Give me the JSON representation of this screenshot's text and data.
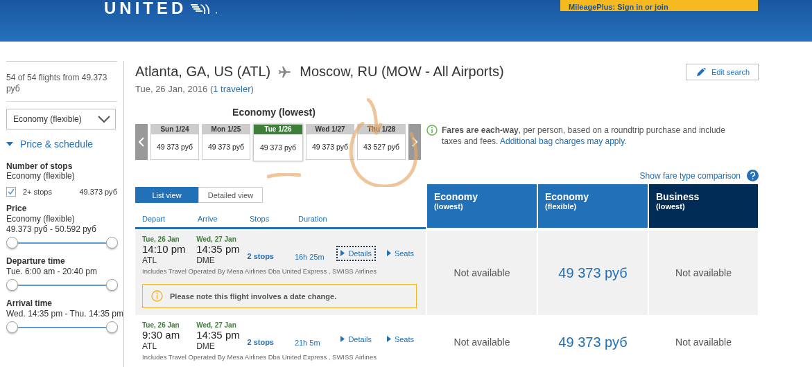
{
  "header": {
    "logo": "UNITED",
    "account_link": "MileagePlus: Sign in or join"
  },
  "sidebar": {
    "summary": "54 of 54 flights from 49.373 руб",
    "cabin_select": "Economy (flexible)",
    "section": {
      "label": "Price & schedule",
      "expanded": true
    },
    "stops": {
      "title": "Number of stops",
      "subtitle": "Economy (flexible)",
      "options": [
        {
          "label": "2+ stops",
          "price": "49.373 руб",
          "checked": true
        }
      ]
    },
    "filters": [
      {
        "title": "Price",
        "subtitle": "Economy (flexible)",
        "range": "49.373 руб - 50.592 руб",
        "thumbs": [
          {
            "level": 0
          },
          {
            "level": 1
          }
        ]
      },
      {
        "title": "Departure time",
        "range": "Tue. 6:00 am - 20:40 pm",
        "thumbs": [
          {
            "level": 0
          },
          {
            "level": 1
          }
        ]
      },
      {
        "title": "Arrival time",
        "range": "Wed. 14:35 pm - Thu. 14:35 pm",
        "thumbs": [
          {
            "level": 0
          },
          {
            "level": 1
          }
        ]
      }
    ]
  },
  "route": {
    "origin": "Atlanta, GA, US (ATL)",
    "destination": "Moscow, RU (MOW - All Airports)",
    "date_prefix": "Tue, 26 Jan, 2016 (",
    "traveler": "1 traveler",
    "date_suffix": ")",
    "edit_button": "Edit search"
  },
  "calendar": {
    "title": "Economy (lowest)",
    "days": [
      {
        "day": "Sun 1/24",
        "price": "49 373 руб",
        "selected": false
      },
      {
        "day": "Mon 1/25",
        "price": "49 373 руб",
        "selected": false
      },
      {
        "day": "Tue 1/26",
        "price": "49 373 руб",
        "selected": true
      },
      {
        "day": "Wed 1/27",
        "price": "49 373 руб",
        "selected": false
      },
      {
        "day": "Thu 1/28",
        "price": "43 527 руб",
        "selected": false
      }
    ]
  },
  "fare_note": {
    "text": "**Fares are each-way**, per person, based on a roundtrip purchase and include taxes and fees.",
    "link": "Additional bag charges may apply."
  },
  "compare_link": "Show fare type comparison",
  "views": [
    {
      "label": "List view",
      "selected": true
    },
    {
      "label": "Detailed view",
      "selected": false
    }
  ],
  "columns": [
    "Depart",
    "Arrive",
    "Stops",
    "Duration"
  ],
  "fare_columns": [
    {
      "name": "Economy",
      "qualifier": "(lowest)",
      "color": "#2170b8"
    },
    {
      "name": "Economy",
      "qualifier": "(flexible)",
      "color": "#2170b8"
    },
    {
      "name": "Business",
      "qualifier": "(lowest)",
      "color": "#002b55"
    }
  ],
  "flights": [
    {
      "highlighted": true,
      "depart_date": "Tue, 26 Jan",
      "depart_time": "14:10 pm",
      "depart_airport": "ATL",
      "arrive_date": "Wed, 27 Jan",
      "arrive_time": "14:35 pm",
      "arrive_airport": "DME",
      "stops": "2 stops",
      "duration": "16h 25m",
      "details": "Details",
      "details_focused": true,
      "seats": "Seats",
      "operated_by": "Includes Travel Operated By Mesa Airlines Dba United Express , SWISS Airlines",
      "warning": "Please note this flight involves a date change.",
      "fares": [
        {
          "kind": "unavailable",
          "text": "Not available"
        },
        {
          "kind": "price",
          "text": "49 373 руб"
        },
        {
          "kind": "unavailable",
          "text": "Not available"
        }
      ]
    },
    {
      "highlighted": false,
      "depart_date": "Tue, 26 Jan",
      "depart_time": "9:30 am",
      "depart_airport": "ATL",
      "arrive_date": "Wed, 27 Jan",
      "arrive_time": "14:35 pm",
      "arrive_airport": "DME",
      "stops": "2 stops",
      "duration": "21h 5m",
      "details": "Details",
      "details_focused": false,
      "seats": "Seats",
      "operated_by": "Includes Travel Operated By Mesa Airlines Dba United Express , SWISS Airlines",
      "fares": [
        {
          "kind": "unavailable",
          "text": "Not available"
        },
        {
          "kind": "price",
          "text": "49 373 руб"
        },
        {
          "kind": "unavailable",
          "text": "Not available"
        }
      ]
    }
  ]
}
